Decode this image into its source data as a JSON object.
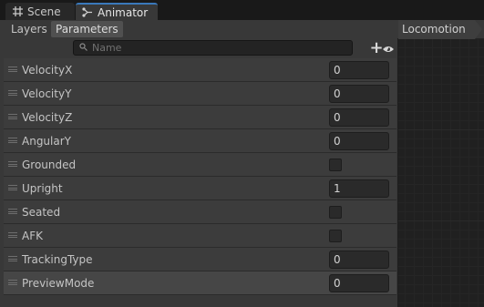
{
  "tabs": {
    "scene": "Scene",
    "animator": "Animator"
  },
  "subtabs": {
    "layers": "Layers",
    "parameters": "Parameters"
  },
  "search": {
    "placeholder": "Name",
    "value": ""
  },
  "add_button": {
    "symbol": "+",
    "caret": "▾"
  },
  "breadcrumb": {
    "label": "Locomotion"
  },
  "parameters": [
    {
      "name": "VelocityX",
      "type": "float",
      "value": "0"
    },
    {
      "name": "VelocityY",
      "type": "float",
      "value": "0"
    },
    {
      "name": "VelocityZ",
      "type": "float",
      "value": "0"
    },
    {
      "name": "AngularY",
      "type": "float",
      "value": "0"
    },
    {
      "name": "Grounded",
      "type": "bool",
      "value": false
    },
    {
      "name": "Upright",
      "type": "float",
      "value": "1"
    },
    {
      "name": "Seated",
      "type": "bool",
      "value": false
    },
    {
      "name": "AFK",
      "type": "bool",
      "value": false
    },
    {
      "name": "TrackingType",
      "type": "int",
      "value": "0"
    },
    {
      "name": "PreviewMode",
      "type": "int",
      "value": "0"
    }
  ],
  "colors": {
    "accent": "#3a79bb",
    "panel": "#383838",
    "row": "#3c3c3c",
    "field": "#2a2a2a",
    "text": "#c4c4c4"
  }
}
